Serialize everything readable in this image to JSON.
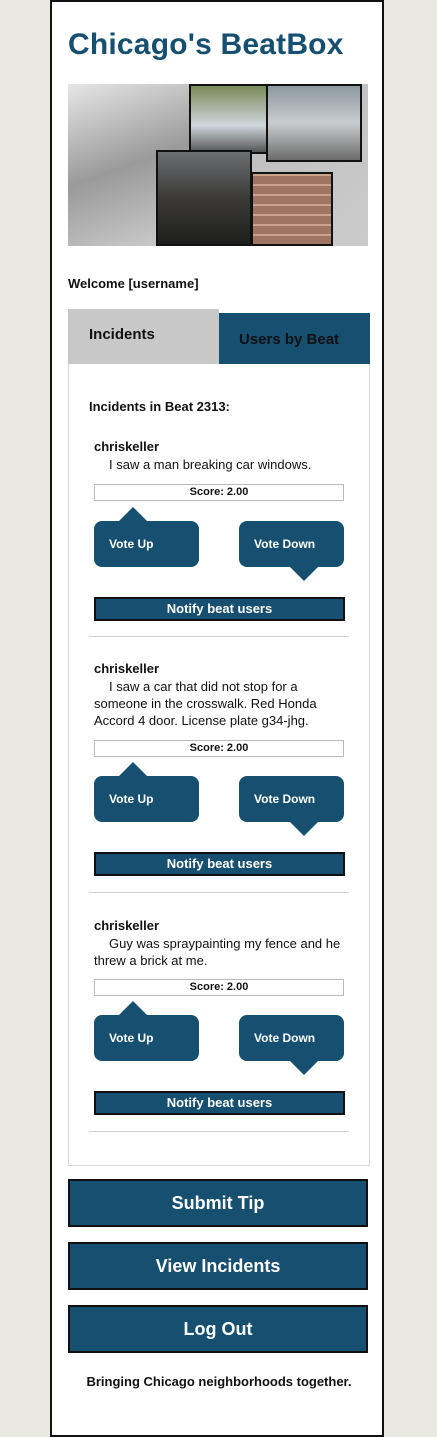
{
  "app": {
    "title": "Chicago's BeatBox",
    "welcome": "Welcome [username]"
  },
  "tabs": {
    "incidents": "Incidents",
    "users_by_beat": "Users by Beat"
  },
  "panel": {
    "heading": "Incidents in Beat 2313:"
  },
  "incidents": [
    {
      "user": "chriskeller",
      "text": "I saw a man breaking car windows.",
      "score": "Score: 2.00",
      "vote_up": "Vote Up",
      "vote_down": "Vote Down",
      "notify": "Notify beat users"
    },
    {
      "user": "chriskeller",
      "text": "I saw a car that did not stop for a someone in the crosswalk. Red Honda Accord 4 door. License plate g34-jhg.",
      "score": "Score: 2.00",
      "vote_up": "Vote Up",
      "vote_down": "Vote Down",
      "notify": "Notify beat users"
    },
    {
      "user": "chriskeller",
      "text": "Guy was spraypainting my fence and he threw a brick at me.",
      "score": "Score: 2.00",
      "vote_up": "Vote Up",
      "vote_down": "Vote Down",
      "notify": "Notify beat users"
    }
  ],
  "actions": {
    "submit_tip": "Submit Tip",
    "view_incidents": "View Incidents",
    "log_out": "Log Out"
  },
  "footer": {
    "tagline": "Bringing Chicago neighborhoods together."
  },
  "colors": {
    "primary": "#164f70",
    "tab_inactive": "#c8c8c8",
    "page_bg": "#e9e9df"
  }
}
